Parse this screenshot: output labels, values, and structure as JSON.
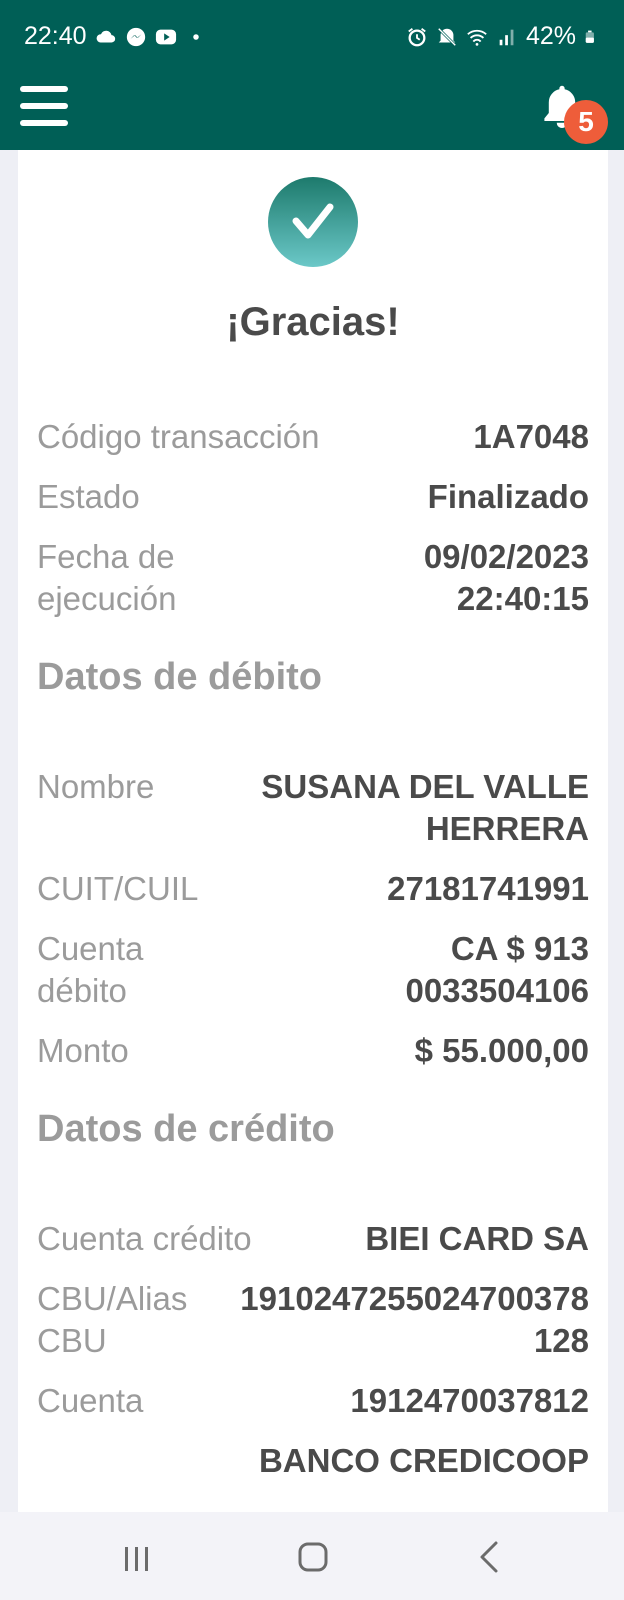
{
  "status_bar": {
    "time": "22:40",
    "battery": "42%",
    "icons_left": [
      "cloud-icon",
      "messenger-icon",
      "youtube-icon",
      "dot-icon"
    ],
    "icons_right": [
      "alarm-icon",
      "mute-icon",
      "wifi-icon",
      "signal-icon",
      "battery-icon"
    ]
  },
  "app_bar": {
    "notification_count": "5"
  },
  "receipt": {
    "title": "¡Gracias!",
    "summary": [
      {
        "label": "Código transacción",
        "value": "1A7048"
      },
      {
        "label": "Estado",
        "value": "Finalizado"
      },
      {
        "label": "Fecha de ejecución",
        "value": "09/02/2023 22:40:15"
      }
    ],
    "debit_heading": "Datos de débito",
    "debit": [
      {
        "label": "Nombre",
        "value": "SUSANA DEL VALLE HERRERA"
      },
      {
        "label": "CUIT/CUIL",
        "value": "27181741991"
      },
      {
        "label": "Cuenta débito",
        "value": "CA $ 913 0033504106"
      },
      {
        "label": "Monto",
        "value": "$ 55.000,00"
      }
    ],
    "credit_heading": "Datos de crédito",
    "credit": [
      {
        "label": "Cuenta crédito",
        "value": "BIEI CARD SA"
      },
      {
        "label": "CBU/Alias CBU",
        "value": "1910247255024700378128"
      },
      {
        "label": "Cuenta",
        "value": "1912470037812"
      },
      {
        "label": "",
        "value": "BANCO CREDICOOP"
      }
    ]
  },
  "colors": {
    "header": "#005f56",
    "badge": "#ee5d3a",
    "label": "#9b9b9b",
    "value": "#4a4a4a"
  }
}
